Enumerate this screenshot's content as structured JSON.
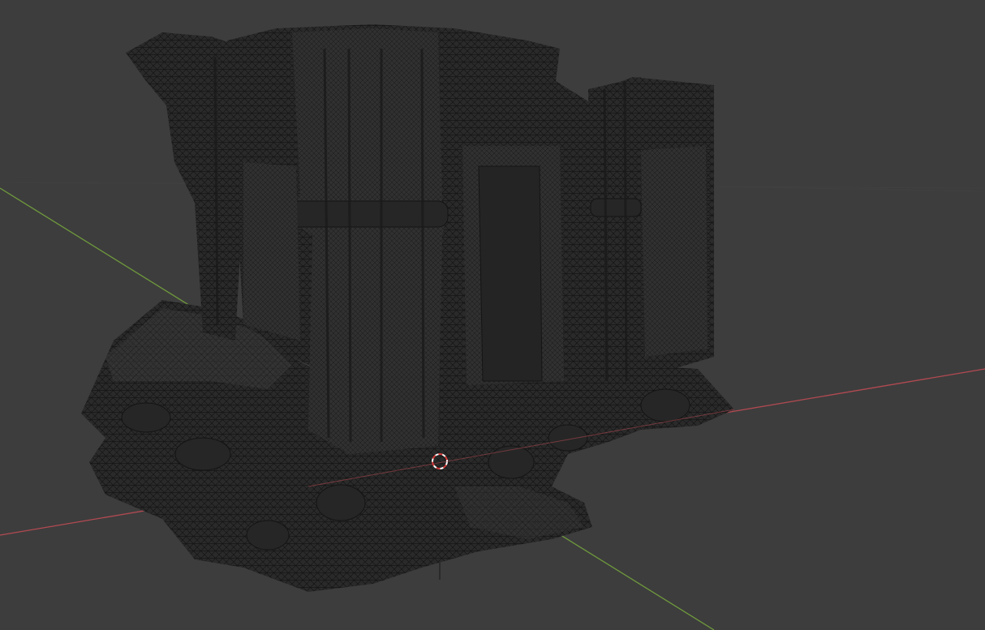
{
  "viewport": {
    "background": "#3d3d3d",
    "grid_color": "#474747",
    "axis_x_color": "#b34a52",
    "axis_y_color": "#6f9a3c",
    "axis_z_color": "#2a2a2a",
    "mesh_fill": "#2b2b2b",
    "mesh_wire": "#121212",
    "cursor_primary": "#d33a3a",
    "cursor_secondary": "#ffffff",
    "icon": "3d-cursor-icon",
    "object_type": "photogrammetry-mesh-ruin"
  }
}
